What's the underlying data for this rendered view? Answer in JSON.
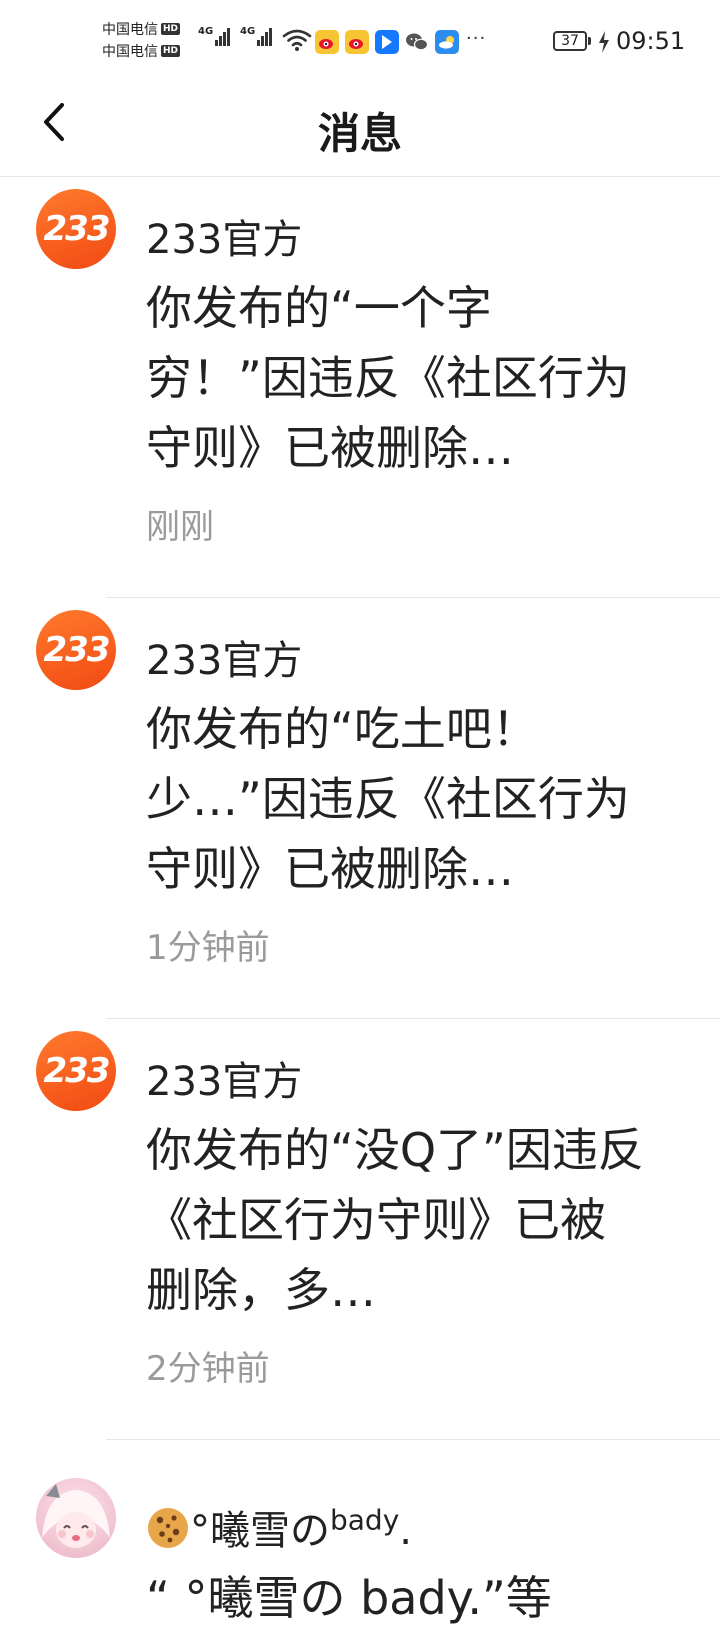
{
  "status_bar": {
    "carrier_1": "中国电信",
    "carrier_2": "中国电信",
    "hd_badge": "HD",
    "network_1": "4G",
    "network_2": "4G",
    "more": "···",
    "battery_level": "37",
    "time": "09:51",
    "icons": [
      "wifi-icon",
      "weibo-icon",
      "weibo-icon",
      "browser-icon",
      "wechat-icon",
      "weather-icon",
      "charging-icon"
    ]
  },
  "header": {
    "title": "消息",
    "back_icon": "chevron-left-icon"
  },
  "messages": [
    {
      "sender": "233官方",
      "avatar_text": "233",
      "text": "你发布的“一个字穷！”因违反《社区行为守则》已被删除…",
      "time": "刚刚"
    },
    {
      "sender": "233官方",
      "avatar_text": "233",
      "text": "你发布的“吃土吧！少…”因违反《社区行为守则》已被删除…",
      "time": "1分钟前"
    },
    {
      "sender": "233官方",
      "avatar_text": "233",
      "text": "你发布的“没Q了”因违反《社区行为守则》已被删除，多…",
      "time": "2分钟前"
    }
  ],
  "user_message": {
    "name_prefix": "°曦雪の",
    "name_sup": "bady",
    "name_suffix": ".",
    "preview": "“ °曦雪の bady.”等"
  },
  "colors": {
    "brand_orange": "#f55a1e",
    "time_gray": "#9a9a9a",
    "divider": "#e6e6e6"
  }
}
